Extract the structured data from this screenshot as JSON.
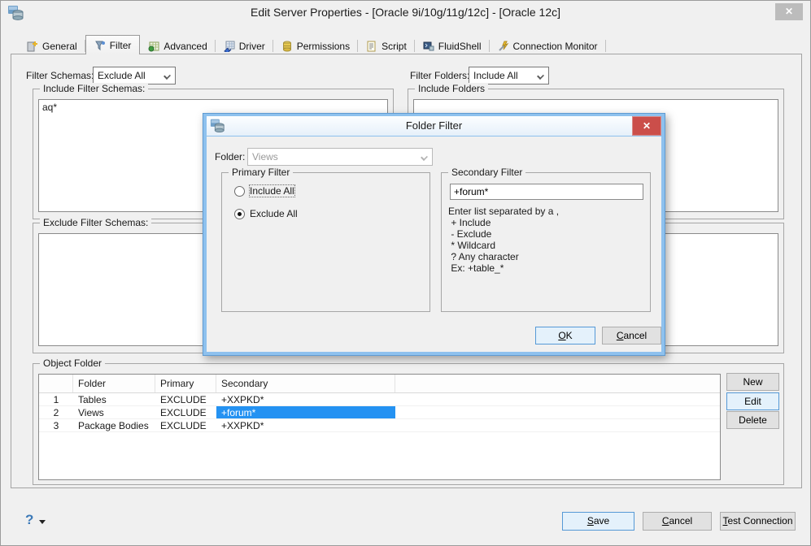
{
  "window": {
    "title": "Edit Server Properties - [Oracle 9i/10g/11g/12c] - [Oracle 12c]",
    "close_glyph": "✕"
  },
  "tabs": [
    {
      "label": "General",
      "icon": "general-icon"
    },
    {
      "label": "Filter",
      "icon": "filter-icon",
      "active": true
    },
    {
      "label": "Advanced",
      "icon": "advanced-icon"
    },
    {
      "label": "Driver",
      "icon": "driver-icon"
    },
    {
      "label": "Permissions",
      "icon": "permissions-icon"
    },
    {
      "label": "Script",
      "icon": "script-icon"
    },
    {
      "label": "FluidShell",
      "icon": "fluidshell-icon"
    },
    {
      "label": "Connection Monitor",
      "icon": "connection-monitor-icon"
    }
  ],
  "filter": {
    "schemas_label": "Filter Schemas:",
    "schemas_value": "Exclude All",
    "folders_label": "Filter Folders:",
    "folders_value": "Include All"
  },
  "groups": {
    "include_schemas": {
      "label": "Include Filter Schemas:",
      "value": "aq*"
    },
    "exclude_schemas": {
      "label": "Exclude Filter Schemas:"
    },
    "include_folders": {
      "label": "Include Folders"
    }
  },
  "object_folder": {
    "label": "Object Folder",
    "columns": [
      "",
      "Folder",
      "Primary",
      "Secondary"
    ],
    "rows": [
      {
        "num": "1",
        "folder": "Tables",
        "primary": "EXCLUDE",
        "secondary": "+XXPKD*"
      },
      {
        "num": "2",
        "folder": "Views",
        "primary": "EXCLUDE",
        "secondary": "+forum*"
      },
      {
        "num": "3",
        "folder": "Package Bodies",
        "primary": "EXCLUDE",
        "secondary": "+XXPKD*"
      }
    ],
    "buttons": {
      "new": "New",
      "edit": "Edit",
      "delete": "Delete"
    }
  },
  "dialog": {
    "title": "Folder Filter",
    "close_glyph": "✕",
    "folder_label": "Folder:",
    "folder_value": "Views",
    "primary": {
      "label": "Primary Filter",
      "include_label": "Include All",
      "exclude_label": "Exclude All",
      "selected": "Exclude All"
    },
    "secondary": {
      "label": "Secondary Filter",
      "value": "+forum*",
      "help": [
        "Enter list separated by a ,",
        " + Include",
        " - Exclude",
        " * Wildcard",
        " ? Any character",
        " Ex: +table_*"
      ]
    },
    "ok": {
      "m": "O",
      "rest": "K"
    },
    "cancel": {
      "m": "C",
      "rest": "ancel"
    }
  },
  "footer": {
    "help": "?",
    "save": {
      "m": "S",
      "rest": "ave"
    },
    "cancel": {
      "m": "C",
      "rest": "ancel"
    },
    "test": {
      "m": "T",
      "rest": "est Connection"
    }
  },
  "colors": {
    "selection_blue": "#2492f2",
    "modal_border_blue": "#8ec1ee",
    "close_red": "#cb4e4a",
    "focus_button_border": "#5599d6"
  }
}
